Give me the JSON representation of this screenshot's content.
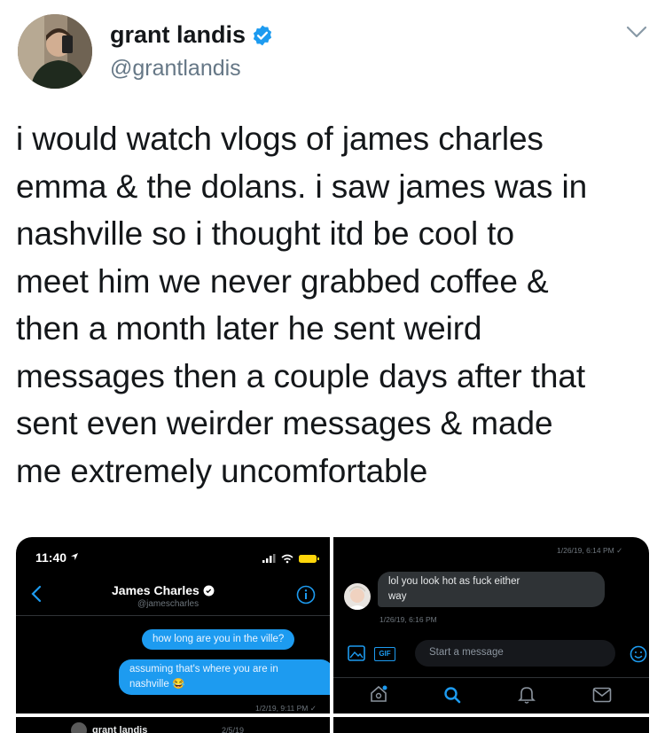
{
  "tweet": {
    "author_name": "grant landis",
    "author_handle": "@grantlandis",
    "lines": [
      "i would watch vlogs of james charles",
      "emma & the dolans. i saw james was in",
      "nashville so i thought itd be cool to",
      "meet him we never grabbed coffee &",
      "then a month later he sent weird",
      "messages then a couple days after that",
      "sent even weirder messages & made",
      "me extremely uncomfortable"
    ],
    "icons": {
      "verified": "verified-badge-icon",
      "more": "chevron-down-icon"
    }
  },
  "screenshot1": {
    "time": "11:40",
    "contact_name": "James Charles",
    "contact_handle": "@jamescharles",
    "messages": [
      "how long are you in the ville?",
      "assuming that's where you are in",
      "nashville 😂"
    ],
    "timestamp": "1/2/19, 9:11 PM"
  },
  "screenshot2": {
    "top_timestamp": "1/26/19, 6:14 PM",
    "message_line1": "lol you look hot as fuck either",
    "message_line2": "way",
    "message_timestamp": "1/26/19, 6:16 PM",
    "gif_label": "GIF",
    "input_placeholder": "Start a message"
  },
  "screenshot3": {
    "name": "grant landis",
    "date": "2/5/19"
  },
  "colors": {
    "brand_blue": "#1d9bf0",
    "text": "#14171a",
    "secondary": "#657786"
  }
}
